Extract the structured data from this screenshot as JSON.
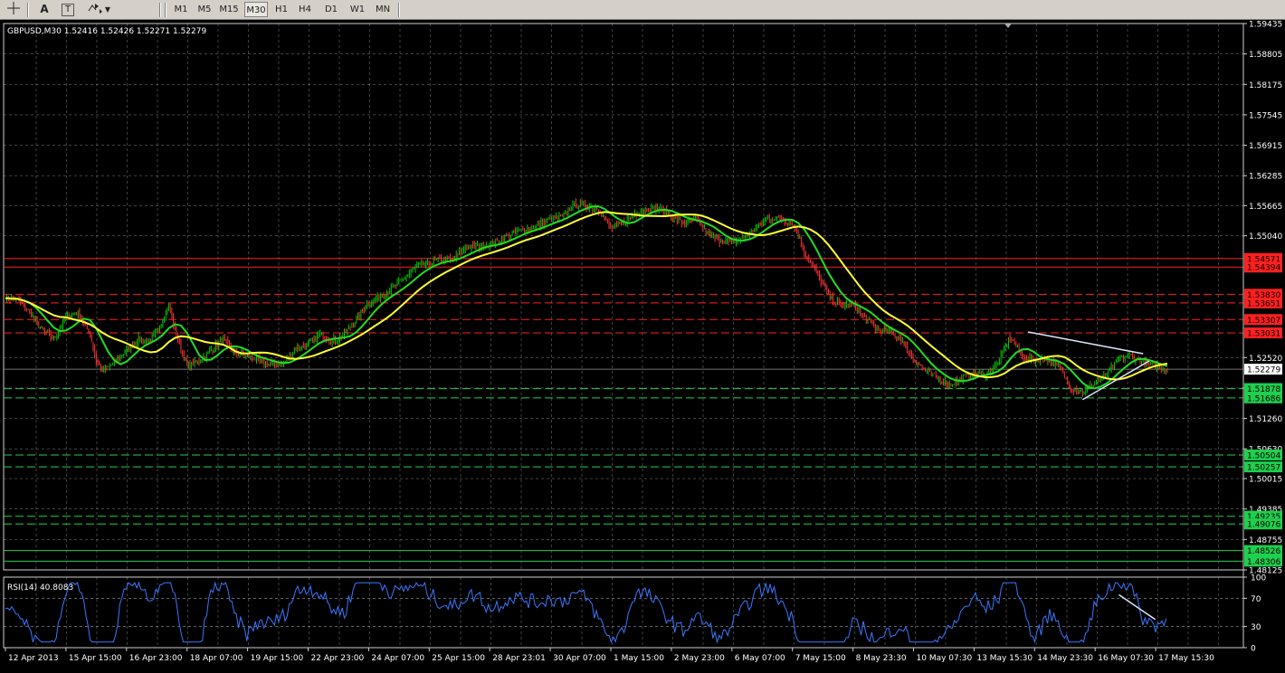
{
  "toolbar": {
    "tool_icons": [
      "crosshair-icon",
      "text-icon",
      "text-label-icon",
      "arrows-icon"
    ],
    "text_tool_label": "A",
    "label_tool_label": "T",
    "timeframes": [
      "M1",
      "M5",
      "M15",
      "M30",
      "H1",
      "H4",
      "D1",
      "W1",
      "MN"
    ],
    "active_timeframe": "M30"
  },
  "chart_header": {
    "symbol_info": "GBPUSD,M30  1.52416 1.52426 1.52271 1.52279"
  },
  "rsi_header": "RSI(14) 40.8083",
  "colors": {
    "background": "#000000",
    "grid": "#c0c0c0",
    "candle_up": "#00cc00",
    "candle_down": "#ff3333",
    "ma_fast": "#22dd22",
    "ma_slow": "#ffff33",
    "rsi_line": "#3b78ff",
    "resistance": "#ff2020",
    "support": "#1fcf4f",
    "trendline": "#dde8ff"
  },
  "chart_data": {
    "type": "candlestick",
    "symbol": "GBPUSD",
    "timeframe": "M30",
    "last_ohlc": {
      "open": 1.52416,
      "high": 1.52426,
      "low": 1.52271,
      "close": 1.52279
    },
    "current_price": 1.52279,
    "ylim": [
      1.48125,
      1.59435
    ],
    "y_ticks": [
      1.59435,
      1.58805,
      1.58175,
      1.57545,
      1.56915,
      1.56285,
      1.55665,
      1.5504,
      1.5252,
      1.5189,
      1.5126,
      1.5063,
      1.50015,
      1.49385,
      1.48755,
      1.48125
    ],
    "x_labels": [
      "12 Apr 2013",
      "15 Apr 15:00",
      "16 Apr 23:00",
      "18 Apr 07:00",
      "19 Apr 15:00",
      "22 Apr 23:00",
      "24 Apr 07:00",
      "25 Apr 15:00",
      "28 Apr 23:01",
      "30 Apr 07:00",
      "1 May 15:00",
      "2 May 23:00",
      "6 May 07:00",
      "7 May 15:00",
      "8 May 23:30",
      "10 May 07:30",
      "13 May 15:30",
      "14 May 23:30",
      "16 May 07:30",
      "17 May 15:30"
    ],
    "price_path": [
      [
        0,
        1.5375
      ],
      [
        2,
        1.5372
      ],
      [
        4,
        1.5345
      ],
      [
        6,
        1.531
      ],
      [
        8,
        1.529
      ],
      [
        10,
        1.5335
      ],
      [
        12,
        1.5345
      ],
      [
        14,
        1.53
      ],
      [
        15,
        1.5245
      ],
      [
        16,
        1.5225
      ],
      [
        18,
        1.524
      ],
      [
        20,
        1.5268
      ],
      [
        22,
        1.529
      ],
      [
        24,
        1.5285
      ],
      [
        26,
        1.533
      ],
      [
        27,
        1.536
      ],
      [
        28,
        1.531
      ],
      [
        29,
        1.527
      ],
      [
        30,
        1.5235
      ],
      [
        32,
        1.5243
      ],
      [
        34,
        1.5268
      ],
      [
        36,
        1.529
      ],
      [
        38,
        1.526
      ],
      [
        40,
        1.5255
      ],
      [
        42,
        1.5245
      ],
      [
        44,
        1.5238
      ],
      [
        46,
        1.524
      ],
      [
        48,
        1.527
      ],
      [
        50,
        1.528
      ],
      [
        52,
        1.53
      ],
      [
        54,
        1.5285
      ],
      [
        56,
        1.53
      ],
      [
        60,
        1.5365
      ],
      [
        64,
        1.5395
      ],
      [
        68,
        1.544
      ],
      [
        72,
        1.5455
      ],
      [
        74,
        1.5455
      ],
      [
        76,
        1.548
      ],
      [
        80,
        1.5485
      ],
      [
        84,
        1.551
      ],
      [
        88,
        1.5525
      ],
      [
        90,
        1.554
      ],
      [
        92,
        1.5542
      ],
      [
        94,
        1.557
      ],
      [
        98,
        1.556
      ],
      [
        100,
        1.552
      ],
      [
        102,
        1.553
      ],
      [
        104,
        1.555
      ],
      [
        106,
        1.556
      ],
      [
        108,
        1.556
      ],
      [
        110,
        1.5545
      ],
      [
        112,
        1.553
      ],
      [
        114,
        1.554
      ],
      [
        116,
        1.551
      ],
      [
        118,
        1.5495
      ],
      [
        120,
        1.549
      ],
      [
        122,
        1.55
      ],
      [
        124,
        1.552
      ],
      [
        126,
        1.554
      ],
      [
        128,
        1.554
      ],
      [
        130,
        1.553
      ],
      [
        131,
        1.5505
      ],
      [
        132,
        1.547
      ],
      [
        134,
        1.543
      ],
      [
        136,
        1.538
      ],
      [
        138,
        1.536
      ],
      [
        140,
        1.536
      ],
      [
        142,
        1.5335
      ],
      [
        144,
        1.531
      ],
      [
        146,
        1.5305
      ],
      [
        148,
        1.529
      ],
      [
        150,
        1.525
      ],
      [
        152,
        1.5225
      ],
      [
        154,
        1.521
      ],
      [
        156,
        1.5195
      ],
      [
        158,
        1.521
      ],
      [
        160,
        1.522
      ],
      [
        162,
        1.5215
      ],
      [
        164,
        1.524
      ],
      [
        166,
        1.5295
      ],
      [
        168,
        1.5255
      ],
      [
        170,
        1.5245
      ],
      [
        172,
        1.525
      ],
      [
        174,
        1.5235
      ],
      [
        176,
        1.519
      ],
      [
        178,
        1.518
      ],
      [
        180,
        1.52
      ],
      [
        182,
        1.5215
      ],
      [
        184,
        1.525
      ],
      [
        186,
        1.5255
      ],
      [
        188,
        1.524
      ],
      [
        190,
        1.5235
      ],
      [
        192,
        1.5228
      ]
    ],
    "path_x_max": 192,
    "moving_averages": [
      {
        "name": "fast",
        "color_key": "ma_fast",
        "period_points": 4
      },
      {
        "name": "slow",
        "color_key": "ma_slow",
        "period_points": 10
      }
    ],
    "price_levels": [
      {
        "value": 1.54571,
        "label": "1.54571",
        "kind": "resistance",
        "style": "solid"
      },
      {
        "value": 1.54394,
        "label": "1.54394",
        "kind": "resistance",
        "style": "solid"
      },
      {
        "value": 1.5383,
        "label": "1.53830",
        "kind": "resistance",
        "style": "dashed"
      },
      {
        "value": 1.53651,
        "label": "1.53651",
        "kind": "resistance",
        "style": "dashed"
      },
      {
        "value": 1.53307,
        "label": "1.53307",
        "kind": "resistance",
        "style": "dashed"
      },
      {
        "value": 1.53031,
        "label": "1.53031",
        "kind": "resistance",
        "style": "dashed"
      },
      {
        "value": 1.51878,
        "label": "1.51878",
        "kind": "support",
        "style": "dashed"
      },
      {
        "value": 1.51686,
        "label": "1.51686",
        "kind": "support",
        "style": "dashed"
      },
      {
        "value": 1.50504,
        "label": "1.50504",
        "kind": "support",
        "style": "dashed"
      },
      {
        "value": 1.50257,
        "label": "1.50257",
        "kind": "support",
        "style": "dashed"
      },
      {
        "value": 1.49235,
        "label": "1.49235",
        "kind": "support",
        "style": "dashed"
      },
      {
        "value": 1.49076,
        "label": "1.49076",
        "kind": "support",
        "style": "dashed"
      },
      {
        "value": 1.48526,
        "label": "1.48526",
        "kind": "support",
        "style": "solid"
      },
      {
        "value": 1.48306,
        "label": "1.48306",
        "kind": "support",
        "style": "solid"
      }
    ],
    "trendlines": [
      {
        "from": [
          169,
          1.5305
        ],
        "to": [
          188,
          1.526
        ]
      },
      {
        "from": [
          178,
          1.5165
        ],
        "to": [
          189,
          1.5245
        ]
      }
    ],
    "rsi": {
      "name": "RSI(14)",
      "period": 14,
      "current": 40.8083,
      "ylim": [
        0,
        100
      ],
      "y_ticks": [
        100,
        70,
        30,
        0
      ],
      "levels": [
        70,
        30
      ],
      "trendline": {
        "from": [
          184,
          75
        ],
        "to": [
          190,
          40
        ]
      }
    }
  }
}
